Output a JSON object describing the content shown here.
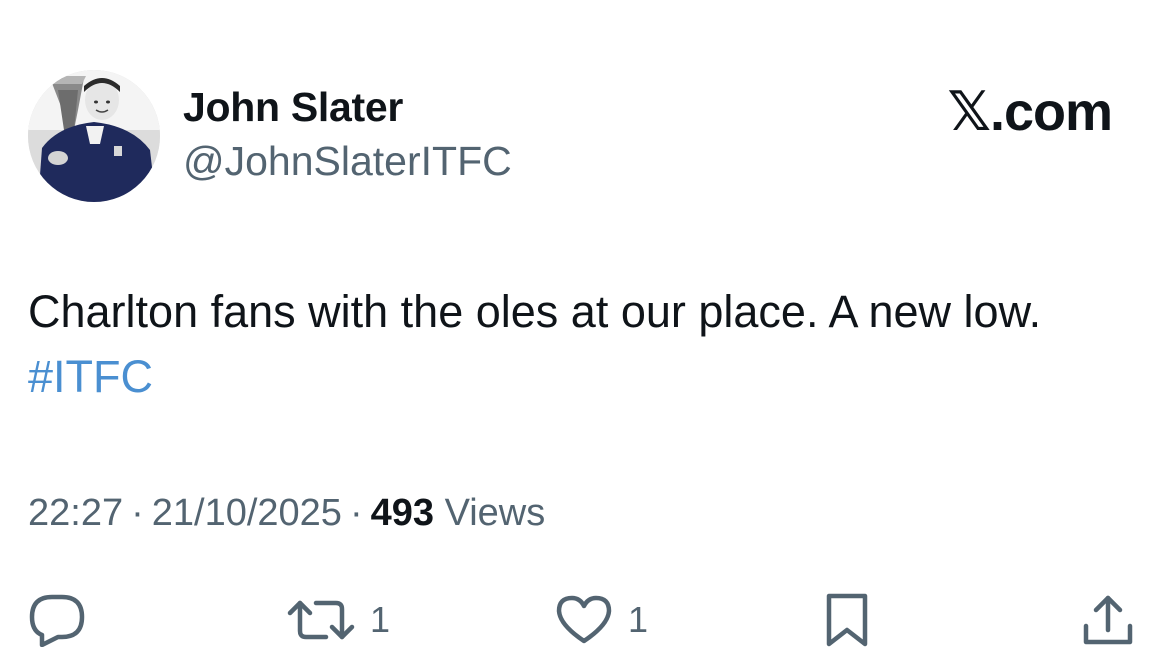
{
  "author": {
    "name": "John Slater",
    "handle": "@JohnSlaterITFC"
  },
  "brand": "𝕏.com",
  "tweet": {
    "text": "Charlton fans with the oles at our place. A new low.",
    "hashtag": "#ITFC"
  },
  "meta": {
    "time": "22:27",
    "separator": "·",
    "date": "21/10/2025",
    "views_count": "493",
    "views_label": "Views"
  },
  "actions": {
    "reply_count": "",
    "retweet_count": "1",
    "like_count": "1"
  },
  "icons": {
    "reply": "speech-bubble-icon",
    "retweet": "retweet-icon",
    "like": "heart-icon",
    "bookmark": "bookmark-icon",
    "share": "share-upload-icon"
  },
  "colors": {
    "text": "#0f1419",
    "secondary": "#536471",
    "hashtag": "#4a8fd1"
  }
}
